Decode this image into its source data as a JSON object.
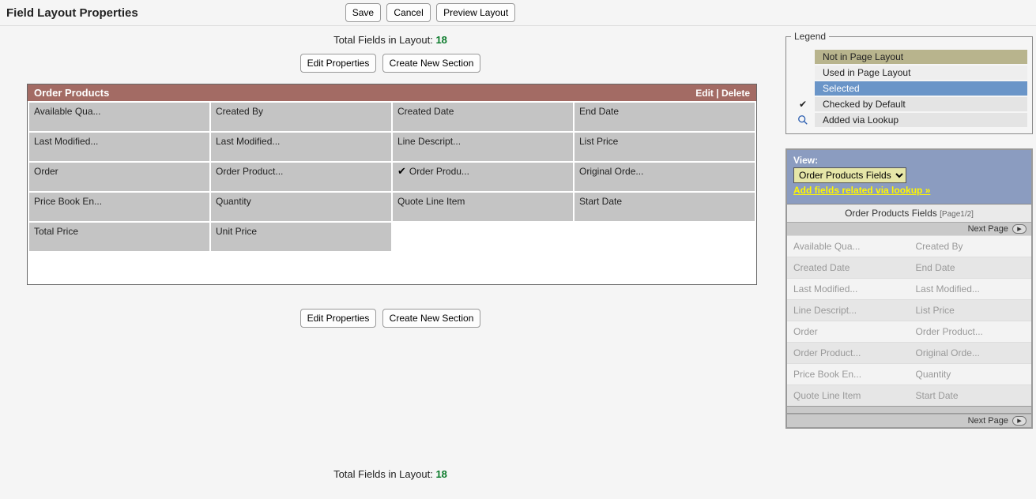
{
  "header": {
    "title": "Field Layout Properties",
    "buttons": {
      "save": "Save",
      "cancel": "Cancel",
      "preview": "Preview Layout"
    }
  },
  "total": {
    "label": "Total Fields in Layout:",
    "count": "18"
  },
  "midButtons": {
    "edit": "Edit Properties",
    "create": "Create New Section"
  },
  "section": {
    "title": "Order Products",
    "editLabel": "Edit",
    "deleteLabel": "Delete",
    "fields": [
      {
        "label": "Available Qua...",
        "checked": false
      },
      {
        "label": "Created By",
        "checked": false
      },
      {
        "label": "Created Date",
        "checked": false
      },
      {
        "label": "End Date",
        "checked": false
      },
      {
        "label": "Last Modified...",
        "checked": false
      },
      {
        "label": "Last Modified...",
        "checked": false
      },
      {
        "label": "Line Descript...",
        "checked": false
      },
      {
        "label": "List Price",
        "checked": false
      },
      {
        "label": "Order",
        "checked": false
      },
      {
        "label": "Order Product...",
        "checked": false
      },
      {
        "label": "Order Produ...",
        "checked": true
      },
      {
        "label": "Original Orde...",
        "checked": false
      },
      {
        "label": "Price Book En...",
        "checked": false
      },
      {
        "label": "Quantity",
        "checked": false
      },
      {
        "label": "Quote Line Item",
        "checked": false
      },
      {
        "label": "Start Date",
        "checked": false
      },
      {
        "label": "Total Price",
        "checked": false
      },
      {
        "label": "Unit Price",
        "checked": false
      }
    ]
  },
  "legend": {
    "title": "Legend",
    "rows": [
      {
        "key": "not",
        "label": "Not in Page Layout"
      },
      {
        "key": "used",
        "label": "Used in Page Layout"
      },
      {
        "key": "sel",
        "label": "Selected"
      },
      {
        "key": "chk",
        "label": "Checked by Default"
      },
      {
        "key": "look",
        "label": "Added via Lookup"
      }
    ]
  },
  "palette": {
    "viewLabel": "View:",
    "viewValue": "Order Products Fields",
    "lookupLink": "Add fields related via lookup »",
    "title": "Order Products Fields",
    "pageInfo": "[Page1/2]",
    "nav": "Next Page",
    "fields": [
      "Available Qua...",
      "Created By",
      "Created Date",
      "End Date",
      "Last Modified...",
      "Last Modified...",
      "Line Descript...",
      "List Price",
      "Order",
      "Order Product...",
      "Order Product...",
      "Original Orde...",
      "Price Book En...",
      "Quantity",
      "Quote Line Item",
      "Start Date"
    ]
  }
}
